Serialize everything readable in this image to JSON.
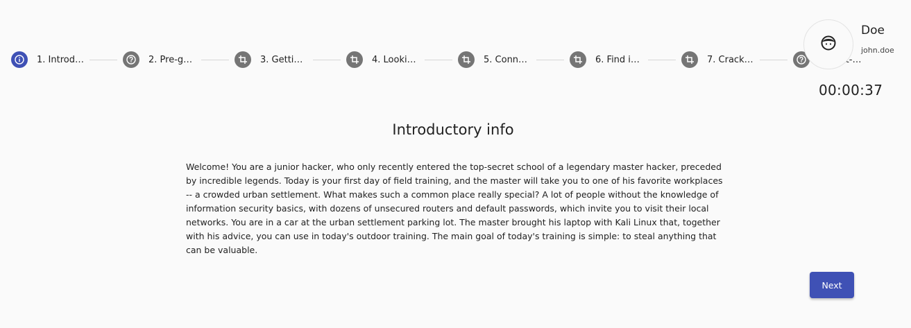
{
  "stepper": {
    "steps": [
      {
        "label": "1. Introdu...",
        "icon": "info-icon",
        "active": true
      },
      {
        "label": "2. Pre-gam...",
        "icon": "help-icon",
        "active": false
      },
      {
        "label": "3. Getting...",
        "icon": "crop-icon",
        "active": false
      },
      {
        "label": "4. Looking...",
        "icon": "crop-icon",
        "active": false
      },
      {
        "label": "5. Connect...",
        "icon": "crop-icon",
        "active": false
      },
      {
        "label": "6. Find in...",
        "icon": "crop-icon",
        "active": false
      },
      {
        "label": "7. Crack t...",
        "icon": "crop-icon",
        "active": false
      },
      {
        "label": "8. Post-ga...",
        "icon": "help-icon",
        "active": false
      }
    ]
  },
  "profile": {
    "name": "Doe",
    "login": "john.doe",
    "avatar_icon": "face-icon"
  },
  "timer": "00:00:37",
  "main": {
    "title": "Introductory info",
    "content": "Welcome! You are a junior hacker, who only recently entered the top-secret school of a legendary master hacker, preceded by incredible legends. Today is your first day of field training, and the master will take you to one of his favorite workplaces -- a crowded urban settlement. What makes such a common place really special? A lot of people without the knowledge of information security basics, with dozens of unsecured routers and default passwords, which invite you to visit their local networks. You are in a car at the urban settlement parking lot. The master brought his laptop with Kali Linux that, together with his advice, you can use in today's outdoor training. The main goal of today's training is simple: to steal anything that can be valuable.",
    "next_label": "Next"
  },
  "colors": {
    "primary": "#3f51b5",
    "inactive_step": "#757575",
    "background": "#fafafa"
  }
}
